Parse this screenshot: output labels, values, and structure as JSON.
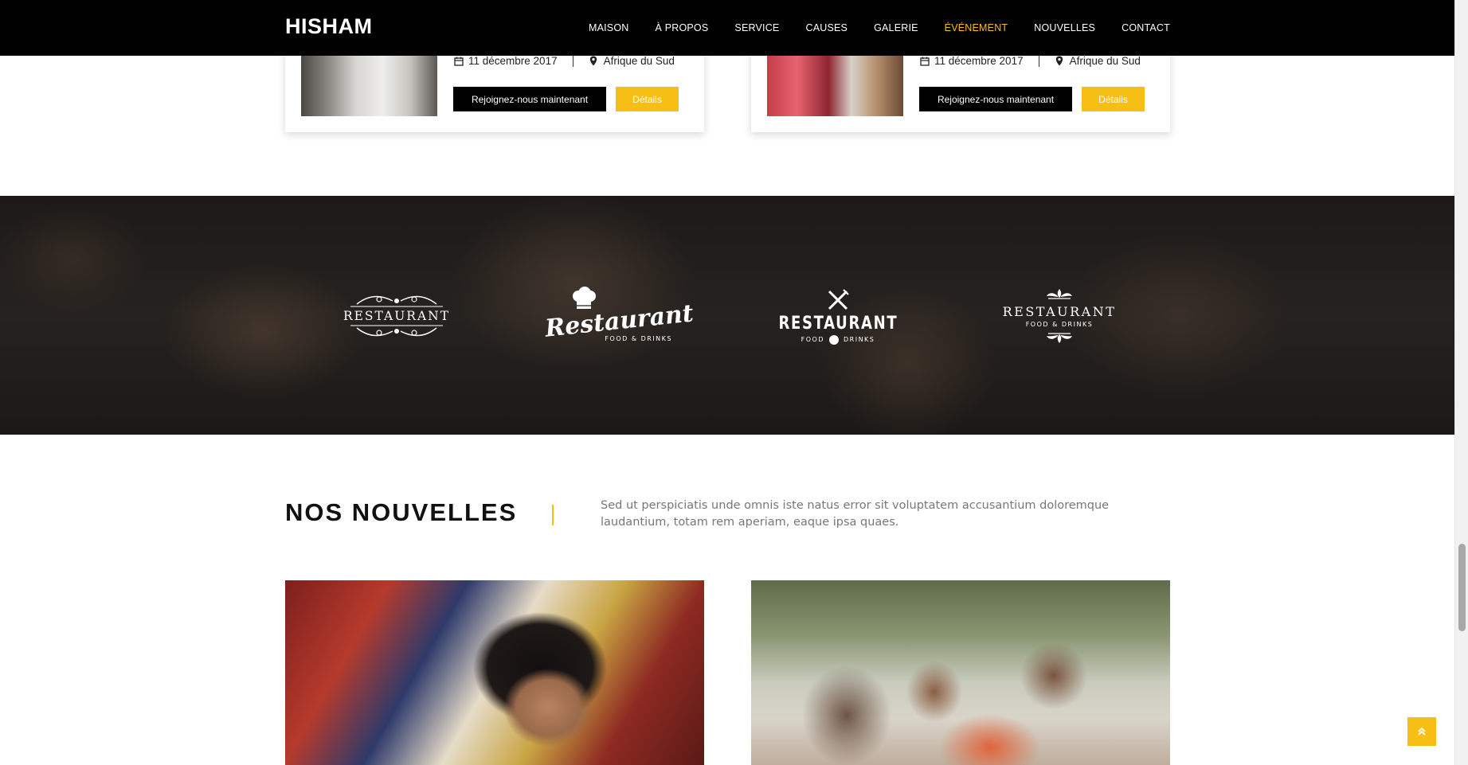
{
  "header": {
    "brand": "HISHAM",
    "nav": [
      "MAISON",
      "À PROPOS",
      "SERVICE",
      "CAUSES",
      "GALERIE",
      "ÉVÉNEMENT",
      "NOUVELLES",
      "CONTACT"
    ],
    "active_nav": "ÉVÉNEMENT"
  },
  "events": [
    {
      "date": "11 décembre 2017",
      "location": "Afrique du Sud",
      "join_label": "Rejoignez-nous maintenant",
      "details_label": "Détails"
    },
    {
      "date": "11 décembre 2017",
      "location": "Afrique du Sud",
      "join_label": "Rejoignez-nous maintenant",
      "details_label": "Détails"
    }
  ],
  "sponsors": [
    {
      "name": "RESTAURANT",
      "icon": "ornament-icon"
    },
    {
      "name": "Restaurant",
      "sub": "FOOD & DRINKS",
      "icon": "chef-hat-icon"
    },
    {
      "name": "RESTAURANT",
      "sub_left": "FOOD",
      "sub_right": "DRINKS",
      "icon": "fork-knife-icon"
    },
    {
      "name": "RESTAURANT",
      "sub": "FOOD & DRINKS",
      "icon": "fleuron-icon"
    }
  ],
  "news": {
    "title": "NOS NOUVELLES",
    "description": "Sed ut perspiciatis unde omnis iste natus error sit voluptatem accusantium doloremque laudantium, totam rem aperiam, eaque ipsa quaes."
  },
  "colors": {
    "accent": "#f7be16",
    "header_bg": "#000000"
  }
}
